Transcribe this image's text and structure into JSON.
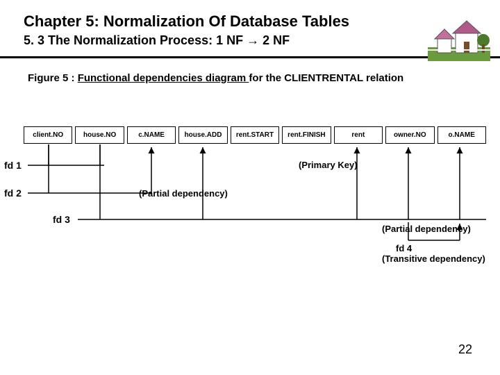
{
  "header": {
    "chapter": "Chapter 5: Normalization Of Database Tables",
    "section_prefix": "5. 3 The Normalization Process: 1 NF ",
    "section_arrow": "→",
    "section_suffix": " 2 NF"
  },
  "figure": {
    "prefix": "Figure 5 : ",
    "underlined": "Functional dependencies diagram ",
    "suffix": "for the CLIENTRENTAL relation"
  },
  "attributes": [
    "client.NO",
    "house.NO",
    "c.NAME",
    "house.ADD",
    "rent.START",
    "rent.FINISH",
    "rent",
    "owner.NO",
    "o.NAME"
  ],
  "fds": {
    "fd1": "fd 1",
    "fd2": "fd 2",
    "fd3": "fd 3"
  },
  "labels": {
    "primary_key": "(Primary Key)",
    "partial1": "(Partial dependency)",
    "partial2": "(Partial dependency)",
    "fd4": "fd 4",
    "transitive": "(Transitive dependency)"
  },
  "page": "22"
}
